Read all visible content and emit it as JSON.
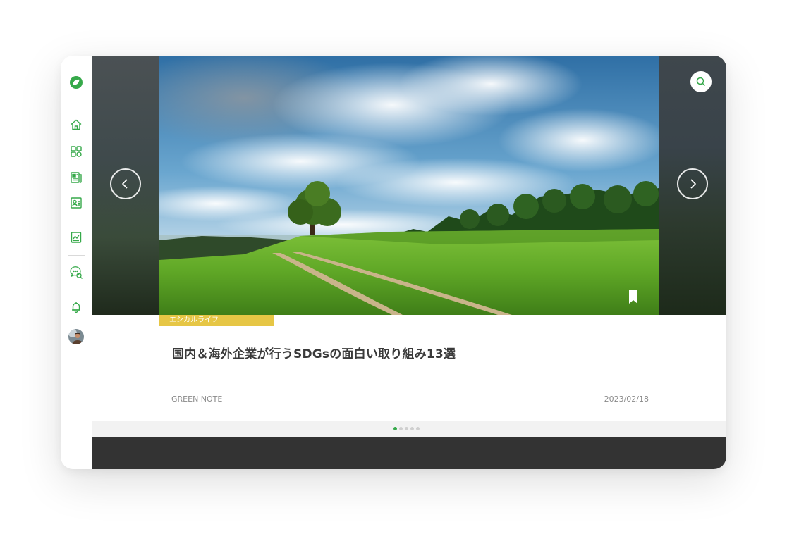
{
  "sidebar": {
    "icons": [
      "logo-icon",
      "home-icon",
      "grid-icon",
      "news-icon",
      "profile-card-icon",
      "report-icon",
      "chat-search-icon",
      "bell-icon",
      "avatar"
    ],
    "accent": "#36a94a"
  },
  "hero": {
    "search_icon": "search-icon",
    "prev_icon": "chevron-left-icon",
    "next_icon": "chevron-right-icon",
    "bookmark_icon": "bookmark-icon"
  },
  "article": {
    "category": "エシカルライフ",
    "category_color": "#e6c645",
    "title": "国内＆海外企業が行うSDGsの面白い取り組み13選",
    "source": "GREEN NOTE",
    "date": "2023/02/18"
  },
  "pagination": {
    "total": 5,
    "active_index": 0
  }
}
